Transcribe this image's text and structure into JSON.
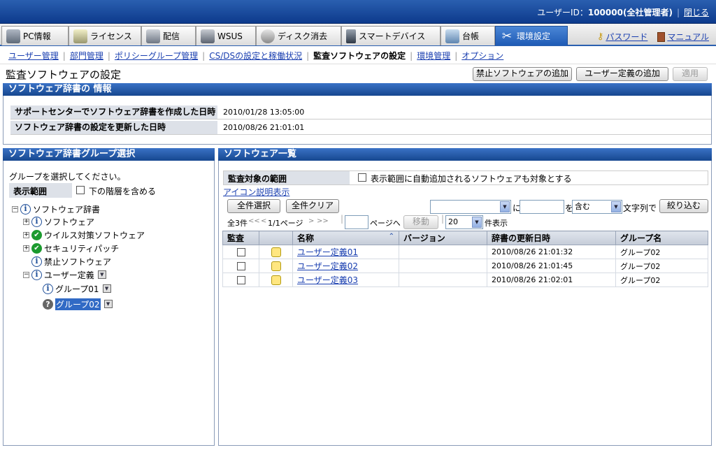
{
  "header": {
    "user_label": "ユーザーID：",
    "user_id": "100000",
    "user_role": "(全社管理者)",
    "close_label": "閉じる"
  },
  "main_tabs": [
    {
      "label": "PC情報",
      "icon": "pc-icon"
    },
    {
      "label": "ライセンス",
      "icon": "license-icon"
    },
    {
      "label": "配信",
      "icon": "delivery-icon"
    },
    {
      "label": "WSUS",
      "icon": "wsus-icon"
    },
    {
      "label": "ディスク消去",
      "icon": "disk-erase-icon"
    },
    {
      "label": "スマートデバイス",
      "icon": "smart-device-icon"
    },
    {
      "label": "台帳",
      "icon": "ledger-icon"
    },
    {
      "label": "環境設定",
      "icon": "settings-icon",
      "active": true
    }
  ],
  "right_links": {
    "password": "パスワード",
    "manual": "マニュアル"
  },
  "sub_tabs": [
    "ユーザー管理",
    "部門管理",
    "ポリシーグループ管理",
    "CS/DSの設定と稼働状況",
    "監査ソフトウェアの設定",
    "環境管理",
    "オプション"
  ],
  "sub_tabs_current": "監査ソフトウェアの設定",
  "page": {
    "title": "監査ソフトウェアの設定",
    "btn_add_prohibited": "禁止ソフトウェアの追加",
    "btn_add_user_def": "ユーザー定義の追加",
    "btn_apply": "適用"
  },
  "dict_info": {
    "header": "ソフトウェア辞書の 情報",
    "rows": [
      {
        "label": "サポートセンターでソフトウェア辞書を作成した日時",
        "value": "2010/01/28 13:05:00"
      },
      {
        "label": "ソフトウェア辞書の設定を更新した日時",
        "value": "2010/08/26 21:01:01"
      }
    ]
  },
  "group_select": {
    "header": "ソフトウェア辞書グループ選択",
    "prompt": "グループを選択してください。",
    "range_label": "表示範囲",
    "include_lower": "下の階層を含める",
    "tree": {
      "root": "ソフトウェア辞書",
      "software": "ソフトウェア",
      "antivirus": "ウイルス対策ソフトウェア",
      "security_patch": "セキュリティパッチ",
      "prohibited": "禁止ソフトウェア",
      "user_def": "ユーザー定義",
      "group01": "グループ01",
      "group02": "グループ02"
    }
  },
  "software_list": {
    "header": "ソフトウェア一覧",
    "scope_label": "監査対象の範囲",
    "scope_option": "表示範囲に自動追加されるソフトウェアも対象とする",
    "icon_help": "アイコン説明表示",
    "btn_select_all": "全件選択",
    "btn_clear_all": "全件クリア",
    "filter_ni": "に",
    "filter_wo": "を",
    "filter_mode": "含む",
    "filter_suffix": "文字列で",
    "btn_filter": "絞り込む",
    "total": "全3件",
    "pager_first": "<<",
    "pager_prev": "<",
    "pager_page": "1/1ページ",
    "pager_next": ">",
    "pager_last": ">>",
    "page_to": "ページへ",
    "btn_move": "移動",
    "per_page": "20",
    "per_page_suffix": "件表示",
    "columns": [
      "監査",
      "",
      "名称",
      "バージョン",
      "辞書の更新日時",
      "グループ名"
    ],
    "rows": [
      {
        "name": "ユーザー定義01",
        "version": "",
        "updated": "2010/08/26 21:01:32",
        "group": "グループ02"
      },
      {
        "name": "ユーザー定義02",
        "version": "",
        "updated": "2010/08/26 21:01:45",
        "group": "グループ02"
      },
      {
        "name": "ユーザー定義03",
        "version": "",
        "updated": "2010/08/26 21:02:01",
        "group": "グループ02"
      }
    ]
  }
}
